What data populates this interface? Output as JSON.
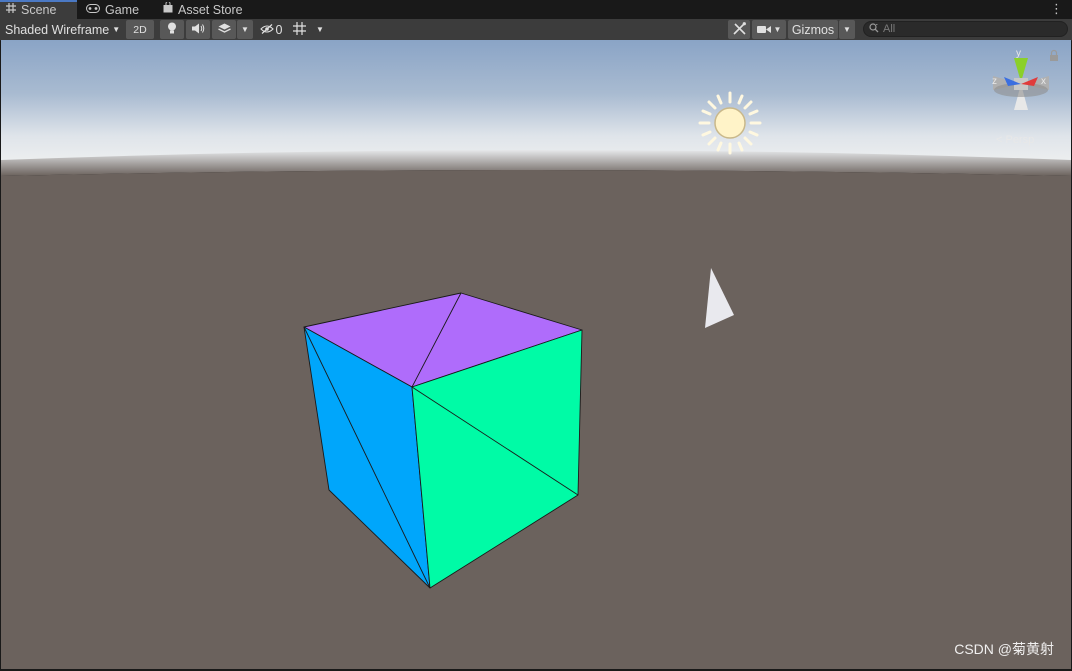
{
  "tabs": [
    {
      "icon": "grid-icon",
      "label": "Scene",
      "active": true
    },
    {
      "icon": "gamepad-icon",
      "label": "Game",
      "active": false
    },
    {
      "icon": "shopping-bag-icon",
      "label": "Asset Store",
      "active": false
    }
  ],
  "toolbar": {
    "draw_mode": "Shaded Wireframe",
    "mode_2d": "2D",
    "hidden_count": "0",
    "gizmos_label": "Gizmos",
    "search_placeholder": "All"
  },
  "viewport": {
    "orientation_label": "< Persp",
    "axis_labels": {
      "x": "x",
      "y": "y",
      "z": "z"
    },
    "watermark": "CSDN @菊黄射"
  },
  "colors": {
    "sky_top": "#8fa9cb",
    "horizon": "#d8dfe6",
    "ground": "#6b625d",
    "cube_top": "#af6cfb",
    "cube_left": "#00a6fb",
    "cube_right": "#00fba6"
  }
}
